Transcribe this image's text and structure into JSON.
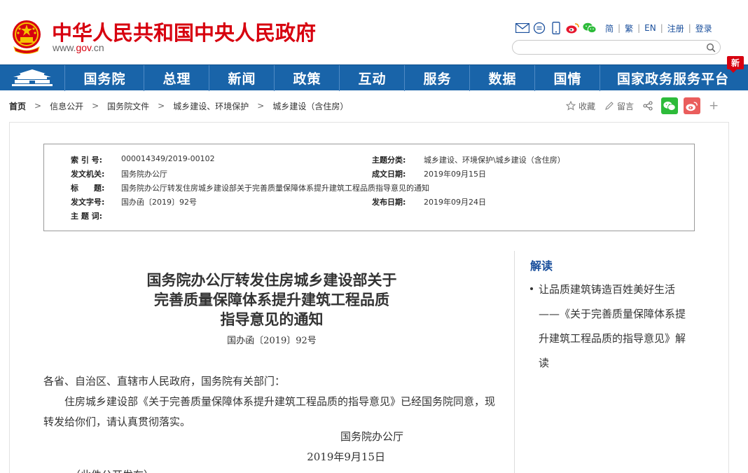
{
  "header": {
    "site_title": "中华人民共和国中央人民政府",
    "site_url_prefix": "www.",
    "site_url_gov": "gov",
    "site_url_suffix": ".cn",
    "tool_icons": [
      "mail-icon",
      "chat-icon",
      "phone-icon",
      "weibo-icon",
      "wechat-icon"
    ],
    "lang_links": [
      "简",
      "繁",
      "EN",
      "注册",
      "登录"
    ],
    "search_placeholder": ""
  },
  "nav": {
    "items": [
      "国务院",
      "总理",
      "新闻",
      "政策",
      "互动",
      "服务",
      "数据",
      "国情",
      "国家政务服务平台"
    ],
    "new_badge": "新"
  },
  "breadcrumb": [
    "首页",
    "信息公开",
    "国务院文件",
    "城乡建设、环境保护",
    "城乡建设（含住房）"
  ],
  "share": {
    "favorite_label": "收藏",
    "comment_label": "留言",
    "plus": "+",
    "colors": {
      "wechat": "#2dbb3a",
      "weibo": "#ea5d5c"
    }
  },
  "meta": {
    "index_label": "索 引 号:",
    "index_value": "000014349/2019-00102",
    "category_label": "主题分类:",
    "category_value": "城乡建设、环境保护\\城乡建设（含住房）",
    "issuer_label": "发文机关:",
    "issuer_value": "国务院办公厅",
    "created_label": "成文日期:",
    "created_value": "2019年09月15日",
    "title_label": "标　　题:",
    "title_value": "国务院办公厅转发住房城乡建设部关于完善质量保障体系提升建筑工程品质指导意见的通知",
    "docno_label": "发文字号:",
    "docno_value": "国办函〔2019〕92号",
    "published_label": "发布日期:",
    "published_value": "2019年09月24日",
    "keywords_label": "主 题 词:",
    "keywords_value": ""
  },
  "article": {
    "title_lines": [
      "国务院办公厅转发住房城乡建设部关于",
      "完善质量保障体系提升建筑工程品质",
      "指导意见的通知"
    ],
    "doc_number": "国办函〔2019〕92号",
    "salutation": "各省、自治区、直辖市人民政府，国务院有关部门：",
    "body": "住房城乡建设部《关于完善质量保障体系提升建筑工程品质的指导意见》已经国务院同意，现转发给你们，请认真贯彻落实。",
    "signature": "国务院办公厅",
    "date": "2019年9月15日",
    "note": "（此件公开发布）"
  },
  "sidebar": {
    "title": "解读",
    "items": [
      "让品质建筑铸造百姓美好生活——《关于完善质量保障体系提升建筑工程品质的指导意见》解读"
    ]
  },
  "colors": {
    "brand_red": "#d7000f",
    "nav_blue": "#1964a9",
    "link_blue": "#1a4f9c"
  }
}
